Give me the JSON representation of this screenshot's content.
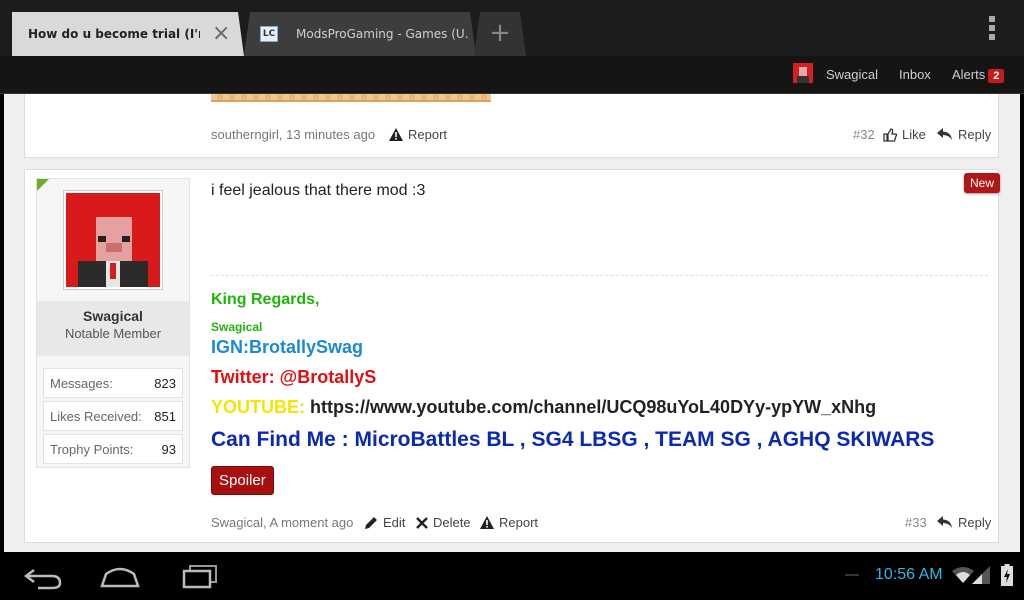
{
  "browser": {
    "tabs": [
      {
        "title": "How do u become trial (I'm no...",
        "active": true
      },
      {
        "title": "ModsProGaming - Games (U...",
        "favicon_text": "LC",
        "active": false
      }
    ]
  },
  "nav": {
    "username": "Swagical",
    "inbox": "Inbox",
    "alerts": "Alerts",
    "alerts_count": "2"
  },
  "prev_post": {
    "author_time": "southerngirl, 13 minutes ago",
    "report": "Report",
    "number": "#32",
    "like": "Like",
    "reply": "Reply"
  },
  "post": {
    "user": {
      "name": "Swagical",
      "title": "Notable Member",
      "stats": [
        {
          "label": "Messages:",
          "value": "823"
        },
        {
          "label": "Likes Received:",
          "value": "851"
        },
        {
          "label": "Trophy Points:",
          "value": "93"
        }
      ]
    },
    "new_badge": "New",
    "message": "i feel jealous that there mod :3",
    "signature": {
      "line1": "King Regards,",
      "line2": "Swagical",
      "ign": "IGN:BrotallySwag",
      "twitter": "Twitter: @BrotallyS",
      "youtube_label": "YOUTUBE:",
      "youtube_url": "https://www.youtube.com/channel/UCQ98uYoL40DYy-ypYW_xNhg",
      "find_me": "Can Find Me : MicroBattles BL , SG4 LBSG , TEAM SG , AGHQ SKIWARS",
      "spoiler": "Spoiler"
    },
    "author_time": "Swagical, A moment ago",
    "edit": "Edit",
    "delete": "Delete",
    "report": "Report",
    "number": "#33",
    "reply": "Reply"
  },
  "system": {
    "clock": "10:56 AM"
  },
  "colors": {
    "sig_green": "#1fb50a",
    "sig_blue": "#1a8ad6",
    "sig_red": "#e01010",
    "sig_yellow": "#f2e600",
    "sig_navy": "#0a2ab0",
    "accent": "#33b5e5"
  }
}
